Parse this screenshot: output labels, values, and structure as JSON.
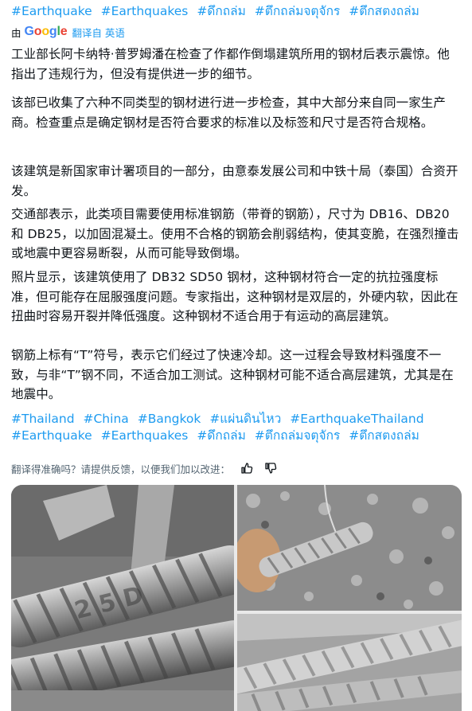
{
  "hashtags_top": [
    "#Earthquake",
    "#Earthquakes",
    "#ดึกถล่ม",
    "#ตึกถล่มจตุจักร",
    "#ตึกสตงถล่ม"
  ],
  "translation": {
    "by_label": "由",
    "provider": "Google",
    "action_label": "翻译自 英语"
  },
  "paragraphs": [
    "工业部长阿卡纳特·普罗姆潘在检查了作都作倒塌建筑所用的钢材后表示震惊。他指出了违规行为，但没有提供进一步的细节。",
    "该部已收集了六种不同类型的钢材进行进一步检查，其中大部分来自同一家生产商。检查重点是确定钢材是否符合要求的标准以及标签和尺寸是否符合规格。",
    "该建筑是新国家审计署项目的一部分，由意泰发展公司和中铁十局（泰国）合资开发。",
    "交通部表示，此类项目需要使用标准钢筋（带脊的钢筋），尺寸为 DB16、DB20 和 DB25，以加固混凝土。使用不合格的钢筋会削弱结构，使其变脆，在强烈撞击或地震中更容易断裂，从而可能导致倒塌。",
    "照片显示，该建筑使用了 DB32 SD50 钢材，这种钢材符合一定的抗拉强度标准，但可能存在屈服强度问题。专家指出，这种钢材是双层的，外硬内软，因此在扭曲时容易开裂并降低强度。这种钢材不适合用于有运动的高层建筑。",
    "钢筋上标有“T”符号，表示它们经过了快速冷却。这一过程会导致材料强度不一致，与非“T”钢不同，不适合加工测试。这种钢材可能不适合高层建筑，尤其是在地震中。"
  ],
  "hashtags_bottom_line1": [
    "#Thailand",
    "#China",
    "#Bangkok",
    "#แผ่นดินไหว",
    "#EarthquakeThailand"
  ],
  "hashtags_bottom_line2": [
    "#Earthquake",
    "#Earthquakes",
    "#ดึกถล่ม",
    "#ตึกถล่มจตุจักร",
    "#ตึกสตงถล่ม"
  ],
  "feedback": {
    "prompt": "翻译得准确吗？请提供反馈，以便我们加以改进：",
    "like_icon": "thumbs-up-icon",
    "dislike_icon": "thumbs-down-icon"
  },
  "photos": [
    {
      "subject": "close-up of ribbed steel rebar stamped 2 5 D"
    },
    {
      "subject": "hand holding rebar sample over gravel"
    },
    {
      "subject": "ribbed rebar bars lying on debris"
    }
  ],
  "colors": {
    "link": "#1d9bf0",
    "text": "#0f1419",
    "muted": "#536471",
    "background": "#ffffff"
  }
}
